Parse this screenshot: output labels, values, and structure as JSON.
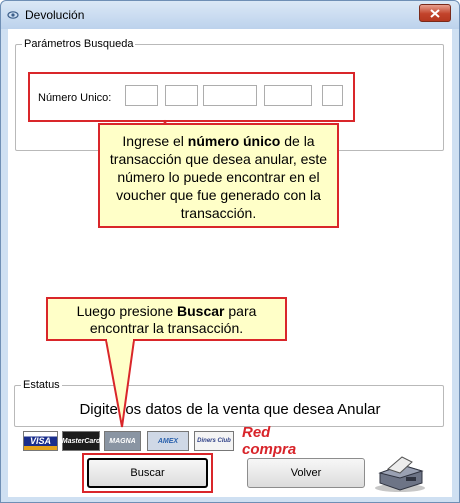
{
  "window": {
    "title": "Devolución",
    "close_symbol": "✕"
  },
  "params_group": {
    "legend": "Parámetros Busqueda",
    "numero_label": "Número Unico:",
    "segments": [
      "",
      "",
      "",
      "",
      ""
    ]
  },
  "callout_1": {
    "before": "Ingrese el ",
    "bold": "número único",
    "after": " de la transacción que desea anular, este número lo puede encontrar en el voucher que fue generado con la transacción."
  },
  "callout_2": {
    "before": "Luego presione ",
    "bold": "Buscar",
    "after": " para encontrar la transacción."
  },
  "estatus_group": {
    "legend": "Estatus",
    "message": "Digite los datos de la venta que desea Anular"
  },
  "cards": {
    "visa": "VISA",
    "mastercard": "MasterCard",
    "magna": "MAGNA",
    "amex": "AMEX",
    "diners": "Diners Club",
    "redcompra": "Red compra"
  },
  "buttons": {
    "buscar": "Buscar",
    "volver": "Volver"
  },
  "icons": [
    "window-icon",
    "close-icon",
    "printer-icon"
  ]
}
